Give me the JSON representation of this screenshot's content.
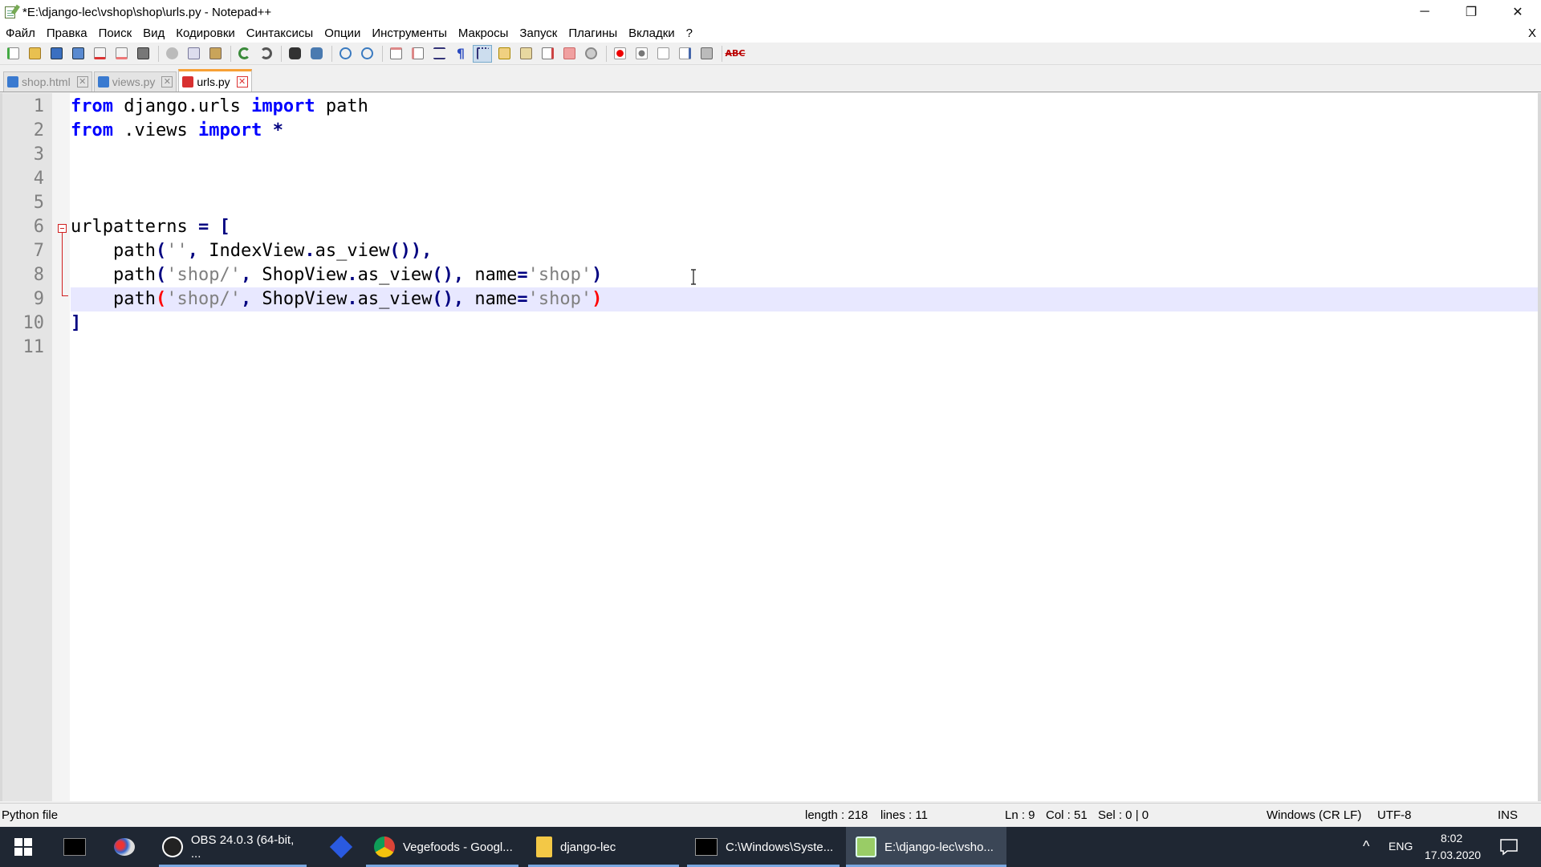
{
  "window": {
    "title": "*E:\\django-lec\\vshop\\shop\\urls.py - Notepad++",
    "controls": {
      "minimize": "─",
      "restore": "❐",
      "close": "✕"
    }
  },
  "menu": {
    "items": [
      "Файл",
      "Правка",
      "Поиск",
      "Вид",
      "Кодировки",
      "Синтаксисы",
      "Опции",
      "Инструменты",
      "Макросы",
      "Запуск",
      "Плагины",
      "Вкладки",
      "?"
    ],
    "close_doc": "X"
  },
  "toolbar": {
    "abc_label": "ABC"
  },
  "tabs": [
    {
      "label": "shop.html",
      "icon": "saved-file-icon",
      "active": false
    },
    {
      "label": "views.py",
      "icon": "saved-file-icon",
      "active": false
    },
    {
      "label": "urls.py",
      "icon": "unsaved-file-icon",
      "active": true
    }
  ],
  "editor": {
    "line_numbers": [
      "1",
      "2",
      "3",
      "4",
      "5",
      "6",
      "7",
      "8",
      "9",
      "10",
      "11"
    ],
    "current_line": 9,
    "lines": [
      [
        [
          "kw",
          "from"
        ],
        [
          "t",
          " django.urls "
        ],
        [
          "kw",
          "import"
        ],
        [
          "t",
          " path"
        ]
      ],
      [
        [
          "kw",
          "from"
        ],
        [
          "t",
          " .views "
        ],
        [
          "kw",
          "import"
        ],
        [
          "t",
          " "
        ],
        [
          "op",
          "*"
        ]
      ],
      [],
      [],
      [],
      [
        [
          "t",
          "urlpatterns "
        ],
        [
          "op",
          "="
        ],
        [
          "t",
          " "
        ],
        [
          "op",
          "["
        ]
      ],
      [
        [
          "t",
          "    path"
        ],
        [
          "op",
          "("
        ],
        [
          "str",
          "''"
        ],
        [
          "op",
          ","
        ],
        [
          "t",
          " IndexView"
        ],
        [
          "op",
          "."
        ],
        [
          "t",
          "as_view"
        ],
        [
          "op",
          "()),"
        ]
      ],
      [
        [
          "t",
          "    path"
        ],
        [
          "op",
          "("
        ],
        [
          "str",
          "'shop/'"
        ],
        [
          "op",
          ","
        ],
        [
          "t",
          " ShopView"
        ],
        [
          "op",
          "."
        ],
        [
          "t",
          "as_view"
        ],
        [
          "op",
          "(),"
        ],
        [
          "t",
          " name"
        ],
        [
          "op",
          "="
        ],
        [
          "str",
          "'shop'"
        ],
        [
          "op",
          ")"
        ]
      ],
      [
        [
          "t",
          "    path"
        ],
        [
          "brace",
          "("
        ],
        [
          "str",
          "'shop/'"
        ],
        [
          "op",
          ","
        ],
        [
          "t",
          " ShopView"
        ],
        [
          "op",
          "."
        ],
        [
          "t",
          "as_view"
        ],
        [
          "op",
          "(),"
        ],
        [
          "t",
          " name"
        ],
        [
          "op",
          "="
        ],
        [
          "str",
          "'shop'"
        ],
        [
          "brace",
          ")"
        ]
      ],
      [
        [
          "op",
          "]"
        ]
      ],
      []
    ]
  },
  "status": {
    "file_type": "Python file",
    "length": "length : 218",
    "lines": "lines : 11",
    "ln": "Ln : 9",
    "col": "Col : 51",
    "sel": "Sel : 0 | 0",
    "eol": "Windows (CR LF)",
    "encoding": "UTF-8",
    "mode": "INS"
  },
  "taskbar": {
    "apps": [
      {
        "label": "OBS 24.0.3 (64-bit, ...",
        "icon": "obs-icon"
      },
      {
        "label": "Vegefoods - Googl...",
        "icon": "chrome-icon"
      },
      {
        "label": "django-lec",
        "icon": "folder-icon"
      },
      {
        "label": "C:\\Windows\\Syste...",
        "icon": "cmd-icon"
      },
      {
        "label": "E:\\django-lec\\vsho...",
        "icon": "notepadpp-icon"
      }
    ],
    "tray": {
      "chevron": "^",
      "lang": "ENG",
      "time": "8:02",
      "date": "17.03.2020"
    }
  },
  "colors": {
    "keyword": "#0000ff",
    "operator": "#000080",
    "string": "#808080",
    "brace_highlight": "#ff0000",
    "current_line": "#e8e8ff",
    "active_tab_accent": "#f7a035",
    "taskbar": "#1f2733"
  }
}
